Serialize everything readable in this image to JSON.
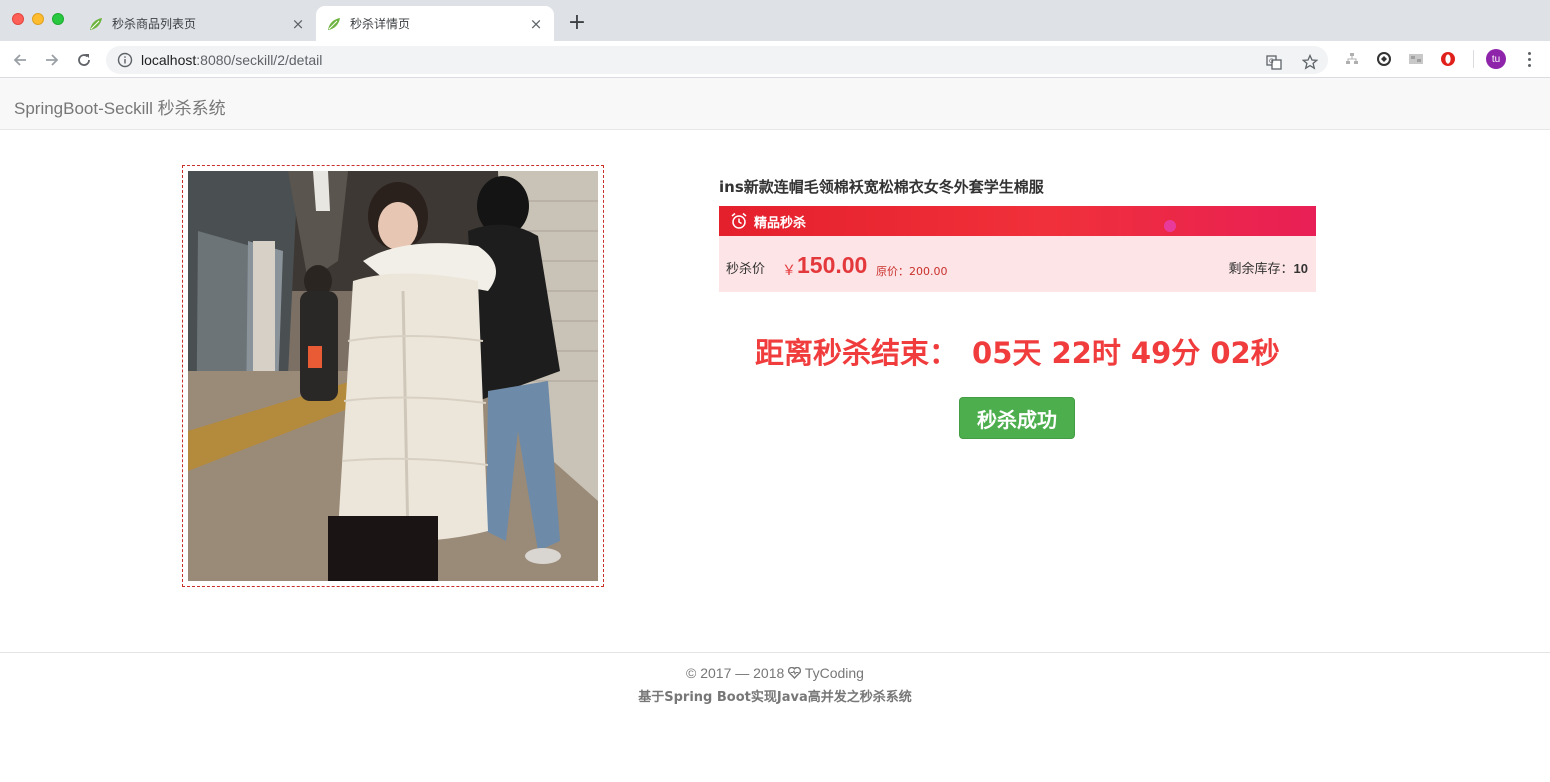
{
  "browser": {
    "tabs": [
      {
        "title": "秒杀商品列表页",
        "active": false
      },
      {
        "title": "秒杀详情页",
        "active": true
      }
    ],
    "close_glyph": "×",
    "new_tab_glyph": "+",
    "url_host": "localhost",
    "url_rest": ":8080/seckill/2/detail",
    "profile_initials": "tu"
  },
  "navbar": {
    "brand": "SpringBoot-Seckill 秒杀系统"
  },
  "product": {
    "title": "ins新款连帽毛领棉袄宽松棉衣女冬外套学生棉服",
    "promo_label": "精品秒杀",
    "price_label": "秒杀价",
    "currency": "￥",
    "price": "150.00",
    "original_price": "原价：200.00",
    "stock_label": "剩余库存：",
    "stock": "10"
  },
  "countdown": {
    "label": "距离秒杀结束：",
    "time": "05天 22时 49分 02秒"
  },
  "action": {
    "button_label": "秒杀成功",
    "button_color": "#4cae4c"
  },
  "footer": {
    "copyright_prefix": "© 2017 — 2018",
    "author": "TyCoding",
    "subtitle": "基于Spring Boot实现Java高并发之秒杀系统"
  },
  "colors": {
    "accent_red": "#e4393c",
    "countdown_red": "#f03c3c",
    "success_green": "#4cae4c"
  }
}
